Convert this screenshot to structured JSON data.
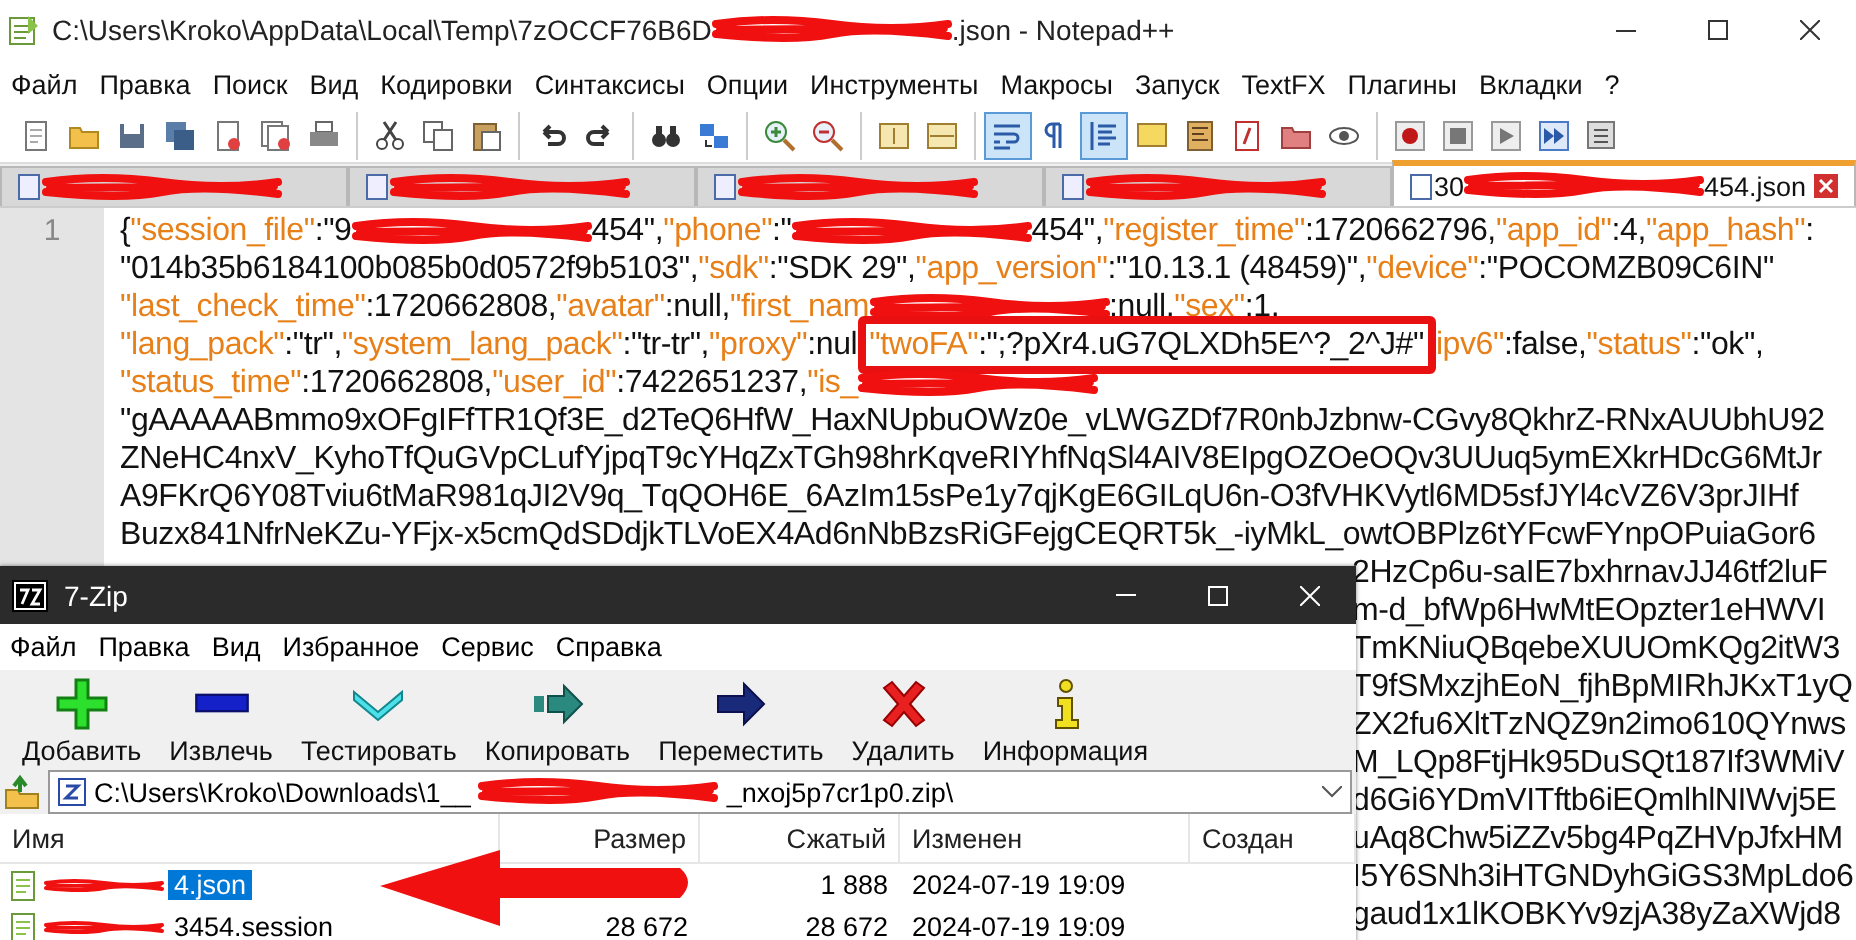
{
  "notepad": {
    "title": [
      {
        "kind": "text",
        "text": "C:\\Users\\Kroko\\AppData\\Local\\Temp\\7zOCCF76B6D"
      },
      {
        "kind": "redacted"
      },
      {
        "kind": "text",
        "text": ".json - Notepad++"
      }
    ],
    "menu": [
      "Файл",
      "Правка",
      "Поиск",
      "Вид",
      "Кодировки",
      "Синтаксисы",
      "Опции",
      "Инструменты",
      "Макросы",
      "Запуск",
      "TextFX",
      "Плагины",
      "Вкладки",
      "?"
    ],
    "toolbar": [
      [
        {
          "kind": "new",
          "selected": false
        },
        {
          "kind": "open",
          "selected": false
        },
        {
          "kind": "save",
          "selected": false
        },
        {
          "kind": "save-all",
          "selected": false
        },
        {
          "kind": "close",
          "selected": false
        },
        {
          "kind": "close-all",
          "selected": false
        },
        {
          "kind": "print",
          "selected": false
        }
      ],
      [
        {
          "kind": "cut",
          "selected": false
        },
        {
          "kind": "copy",
          "selected": false
        },
        {
          "kind": "paste",
          "selected": false
        }
      ],
      [
        {
          "kind": "undo",
          "selected": false
        },
        {
          "kind": "redo",
          "selected": false
        }
      ],
      [
        {
          "kind": "find",
          "selected": false
        },
        {
          "kind": "replace",
          "selected": false
        }
      ],
      [
        {
          "kind": "zoom-in",
          "selected": false
        },
        {
          "kind": "zoom-out",
          "selected": false
        }
      ],
      [
        {
          "kind": "sync-v",
          "selected": false
        },
        {
          "kind": "sync-h",
          "selected": false
        }
      ],
      [
        {
          "kind": "wrap",
          "selected": true
        },
        {
          "kind": "all-chars",
          "selected": false
        },
        {
          "kind": "indent",
          "selected": true
        },
        {
          "kind": "note",
          "selected": false
        },
        {
          "kind": "map",
          "selected": false
        },
        {
          "kind": "function",
          "selected": false
        },
        {
          "kind": "folder",
          "selected": false
        },
        {
          "kind": "monitor",
          "selected": false
        }
      ],
      [
        {
          "kind": "record",
          "selected": false
        },
        {
          "kind": "stop",
          "selected": false
        },
        {
          "kind": "play",
          "selected": false
        },
        {
          "kind": "play-multi",
          "selected": false
        },
        {
          "kind": "save-macro",
          "selected": false
        }
      ]
    ],
    "tabs": [
      {
        "selected": false,
        "segments": [
          {
            "kind": "redacted"
          }
        ]
      },
      {
        "selected": false,
        "segments": [
          {
            "kind": "redacted"
          }
        ]
      },
      {
        "selected": false,
        "segments": [
          {
            "kind": "redacted"
          }
        ]
      },
      {
        "selected": false,
        "segments": [
          {
            "kind": "redacted"
          }
        ]
      },
      {
        "selected": true,
        "segments": [
          {
            "kind": "text",
            "text": "30"
          },
          {
            "kind": "redacted"
          },
          {
            "kind": "text",
            "text": "454.json"
          }
        ]
      }
    ],
    "line_number": "1",
    "lines": [
      {
        "covered": false,
        "segments": [
          {
            "kind": "text",
            "text": "{"
          },
          {
            "kind": "key",
            "text": "\"session_file\""
          },
          {
            "kind": "text",
            "text": ":\"9"
          },
          {
            "kind": "redacted"
          },
          {
            "kind": "text",
            "text": "454\","
          },
          {
            "kind": "key",
            "text": "\"phone\""
          },
          {
            "kind": "text",
            "text": ":\""
          },
          {
            "kind": "redacted"
          },
          {
            "kind": "text",
            "text": "454\","
          },
          {
            "kind": "key",
            "text": "\"register_time\""
          },
          {
            "kind": "text",
            "text": ":1720662796,"
          },
          {
            "kind": "key",
            "text": "\"app_id\""
          },
          {
            "kind": "text",
            "text": ":4,"
          },
          {
            "kind": "key",
            "text": "\"app_hash\""
          },
          {
            "kind": "text",
            "text": ":"
          }
        ]
      },
      {
        "covered": false,
        "segments": [
          {
            "kind": "text",
            "text": "\"014b35b6184100b085b0d0572f9b5103\","
          },
          {
            "kind": "key",
            "text": "\"sdk\""
          },
          {
            "kind": "text",
            "text": ":\"SDK 29\","
          },
          {
            "kind": "key",
            "text": "\"app_version\""
          },
          {
            "kind": "text",
            "text": ":\"10.13.1 (48459)\","
          },
          {
            "kind": "key",
            "text": "\"device\""
          },
          {
            "kind": "text",
            "text": ":\"POCOMZB09C6IN\""
          }
        ]
      },
      {
        "covered": false,
        "segments": [
          {
            "kind": "key",
            "text": "\"last_check_time\""
          },
          {
            "kind": "text",
            "text": ":1720662808,"
          },
          {
            "kind": "key",
            "text": "\"avatar\""
          },
          {
            "kind": "text",
            "text": ":null,"
          },
          {
            "kind": "key",
            "text": "\"first_nam"
          },
          {
            "kind": "redacted"
          },
          {
            "kind": "text",
            "text": ":null,"
          },
          {
            "kind": "key",
            "text": "\"sex\""
          },
          {
            "kind": "text",
            "text": ":1,"
          }
        ]
      },
      {
        "covered": false,
        "segments": [
          {
            "kind": "key",
            "text": "\"lang_pack\""
          },
          {
            "kind": "text",
            "text": ":\"tr\","
          },
          {
            "kind": "key",
            "text": "\"system_lang_pack\""
          },
          {
            "kind": "text",
            "text": ":\"tr-tr\","
          },
          {
            "kind": "key",
            "text": "\"proxy\""
          },
          {
            "kind": "text",
            "text": ":nul"
          },
          {
            "kind": "box",
            "segments": [
              {
                "kind": "key",
                "text": "\"twoFA\""
              },
              {
                "kind": "text",
                "text": ":\";?pXr4.uG7QLXDh5E^?_2^J#\""
              }
            ]
          },
          {
            "kind": "key",
            "text": "ipv6\""
          },
          {
            "kind": "text",
            "text": ":false,"
          },
          {
            "kind": "key",
            "text": "\"status\""
          },
          {
            "kind": "text",
            "text": ":\"ok\","
          }
        ]
      },
      {
        "covered": false,
        "segments": [
          {
            "kind": "key",
            "text": "\"status_time\""
          },
          {
            "kind": "text",
            "text": ":1720662808,"
          },
          {
            "kind": "key",
            "text": "\"user_id\""
          },
          {
            "kind": "text",
            "text": ":7422651237,"
          },
          {
            "kind": "key",
            "text": "\"is_"
          },
          {
            "kind": "redacted"
          }
        ]
      },
      {
        "covered": false,
        "segments": [
          {
            "kind": "text",
            "text": "\"gAAAAABmmo9xOFgIFfTR1Qf3E_d2TeQ6HfW_HaxNUpbuOWz0e_vLWGZDf7R0nbJzbnw-CGvy8QkhrZ-RNxAUUbhU92"
          }
        ]
      },
      {
        "covered": false,
        "segments": [
          {
            "kind": "text",
            "text": "ZNeHC4nxV_KyhoTfQuGVpCLufYjpqT9cYHqZxTGh98hrKqveRIYhfNqSl4AIV8EIpgOZOeOQv3UUuq5ymEXkrHDcG6MtJr"
          }
        ]
      },
      {
        "covered": false,
        "segments": [
          {
            "kind": "text",
            "text": "A9FKrQ6Y08Tviu6tMaR981qJI2V9q_TqQOH6E_6AzIm15sPe1y7qjKgE6GILqU6n-O3fVHKVytl6MD5sfJYl4cVZ6V3prJIHf"
          }
        ]
      },
      {
        "covered": false,
        "segments": [
          {
            "kind": "text",
            "text": "Buzx841NfrNeKZu-YFjx-x5cmQdSDdjkTLVoEX4Ad6nNbBzsRiGFejgCEQRT5k_-iyMkL_owtOBPlz6tYFcwFYnpOPuiaGor6"
          }
        ]
      },
      {
        "covered": true,
        "segments": [
          {
            "kind": "text",
            "text": "2HzCp6u-saIE7bxhrnavJJ46tf2luF"
          }
        ]
      },
      {
        "covered": true,
        "segments": [
          {
            "kind": "text",
            "text": "m-d_bfWp6HwMtEOpzter1eHWVI"
          }
        ]
      },
      {
        "covered": true,
        "segments": [
          {
            "kind": "text",
            "text": "TmKNiuQBqebeXUUOmKQg2itW3"
          }
        ]
      },
      {
        "covered": true,
        "segments": [
          {
            "kind": "text",
            "text": "T9fSMxzjhEoN_fjhBpMIRhJKxT1yQ"
          }
        ]
      },
      {
        "covered": true,
        "segments": [
          {
            "kind": "text",
            "text": "ZX2fu6XltTzNQZ9n2imo610QYnws"
          }
        ]
      },
      {
        "covered": true,
        "segments": [
          {
            "kind": "text",
            "text": "M_LQp8FtjHk95DuSQt187If3WMiV"
          }
        ]
      },
      {
        "covered": true,
        "segments": [
          {
            "kind": "text",
            "text": "d6Gi6YDmVITftb6iEQmlhlNIWvj5E"
          }
        ]
      },
      {
        "covered": true,
        "segments": [
          {
            "kind": "text",
            "text": "uAq8Chw5iZZv5bg4PqZHVpJfxHM"
          }
        ]
      },
      {
        "covered": true,
        "segments": [
          {
            "kind": "text",
            "text": "I5Y6SNh3iHTGNDyhGiGS3MpLdo6"
          }
        ]
      },
      {
        "covered": true,
        "segments": [
          {
            "kind": "text",
            "text": "gaud1x1lKOBKYv9zjA38yZaXWjd8"
          }
        ]
      }
    ]
  },
  "sevenzip": {
    "title": "7-Zip",
    "menu": [
      "Файл",
      "Правка",
      "Вид",
      "Избранное",
      "Сервис",
      "Справка"
    ],
    "toolbar": [
      {
        "kind": "add",
        "label": "Добавить"
      },
      {
        "kind": "extract",
        "label": "Извлечь"
      },
      {
        "kind": "test",
        "label": "Тестировать"
      },
      {
        "kind": "copy",
        "label": "Копировать"
      },
      {
        "kind": "move",
        "label": "Переместить"
      },
      {
        "kind": "delete",
        "label": "Удалить"
      },
      {
        "kind": "info",
        "label": "Информация"
      }
    ],
    "path": [
      {
        "kind": "text",
        "text": "C:\\Users\\Kroko\\Downloads\\1__"
      },
      {
        "kind": "redacted"
      },
      {
        "kind": "text",
        "text": "_nxoj5p7cr1p0.zip\\"
      }
    ],
    "columns": [
      "Имя",
      "Размер",
      "Сжатый",
      "Изменен",
      "Создан"
    ],
    "rows": [
      {
        "selected": true,
        "name": "4.json",
        "packed": "1 888",
        "modified": "2024-07-19 19:09"
      },
      {
        "selected": false,
        "name": "3454.session",
        "size": "28 672",
        "packed": "28 672",
        "modified": "2024-07-19 19:09"
      }
    ]
  }
}
